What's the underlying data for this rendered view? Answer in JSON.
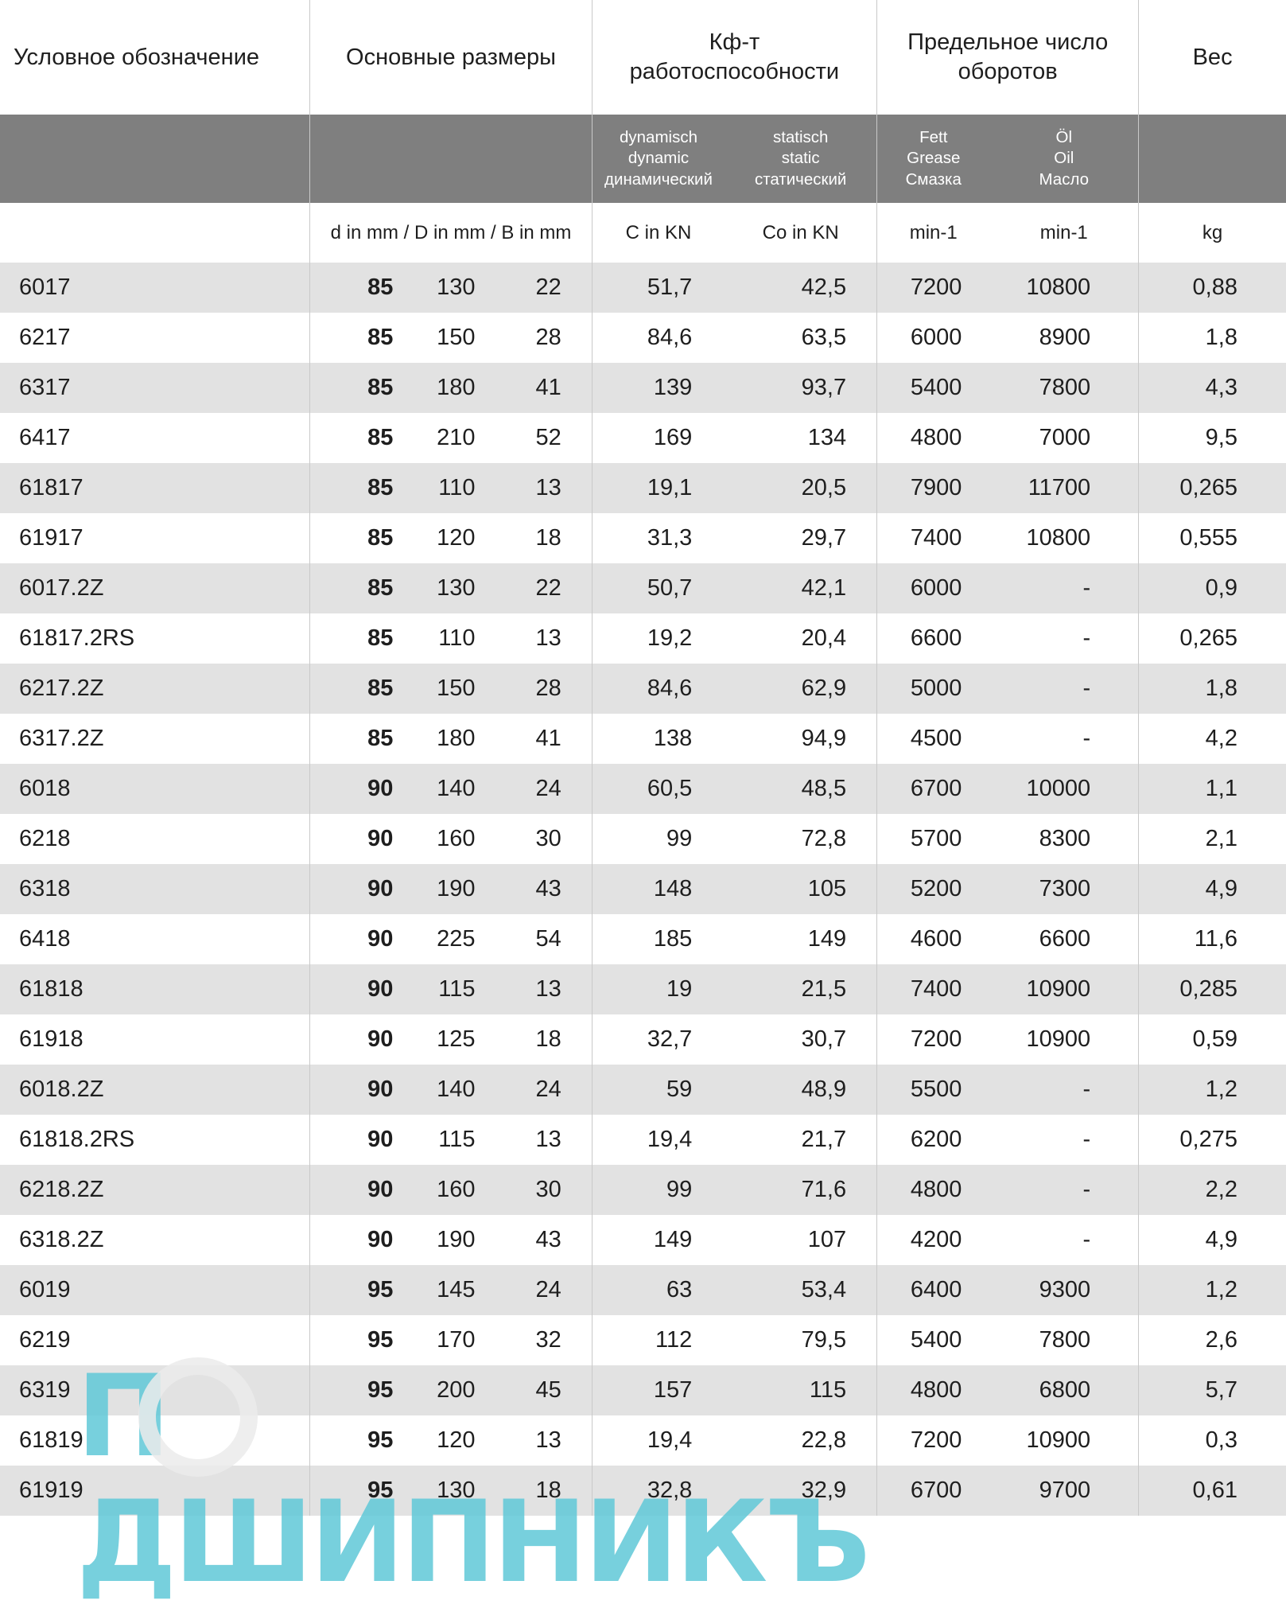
{
  "headers": {
    "designation": "Условное обозначение",
    "dimensions": "Основные размеры",
    "load_line1": "Кф-т",
    "load_line2": "работоспособности",
    "speed_line1": "Предельное число",
    "speed_line2": "оборотов",
    "weight": "Вес"
  },
  "subheaders": {
    "dynamic": [
      "dynamisch",
      "dynamic",
      "динамический"
    ],
    "static": [
      "statisch",
      "static",
      "статический"
    ],
    "grease": [
      "Fett",
      "Grease",
      "Смазка"
    ],
    "oil": [
      "Öl",
      "Oil",
      "Масло"
    ]
  },
  "units": {
    "dimensions": "d in mm / D in mm / B in mm",
    "c": "C in KN",
    "co": "Co in KN",
    "grease": "min-1",
    "oil": "min-1",
    "weight": "kg"
  },
  "rows": [
    [
      "6017",
      "85",
      "130",
      "22",
      "51,7",
      "42,5",
      "7200",
      "10800",
      "0,88"
    ],
    [
      "6217",
      "85",
      "150",
      "28",
      "84,6",
      "63,5",
      "6000",
      "8900",
      "1,8"
    ],
    [
      "6317",
      "85",
      "180",
      "41",
      "139",
      "93,7",
      "5400",
      "7800",
      "4,3"
    ],
    [
      "6417",
      "85",
      "210",
      "52",
      "169",
      "134",
      "4800",
      "7000",
      "9,5"
    ],
    [
      "61817",
      "85",
      "110",
      "13",
      "19,1",
      "20,5",
      "7900",
      "11700",
      "0,265"
    ],
    [
      "61917",
      "85",
      "120",
      "18",
      "31,3",
      "29,7",
      "7400",
      "10800",
      "0,555"
    ],
    [
      "6017.2Z",
      "85",
      "130",
      "22",
      "50,7",
      "42,1",
      "6000",
      "-",
      "0,9"
    ],
    [
      "61817.2RS",
      "85",
      "110",
      "13",
      "19,2",
      "20,4",
      "6600",
      "-",
      "0,265"
    ],
    [
      "6217.2Z",
      "85",
      "150",
      "28",
      "84,6",
      "62,9",
      "5000",
      "-",
      "1,8"
    ],
    [
      "6317.2Z",
      "85",
      "180",
      "41",
      "138",
      "94,9",
      "4500",
      "-",
      "4,2"
    ],
    [
      "6018",
      "90",
      "140",
      "24",
      "60,5",
      "48,5",
      "6700",
      "10000",
      "1,1"
    ],
    [
      "6218",
      "90",
      "160",
      "30",
      "99",
      "72,8",
      "5700",
      "8300",
      "2,1"
    ],
    [
      "6318",
      "90",
      "190",
      "43",
      "148",
      "105",
      "5200",
      "7300",
      "4,9"
    ],
    [
      "6418",
      "90",
      "225",
      "54",
      "185",
      "149",
      "4600",
      "6600",
      "11,6"
    ],
    [
      "61818",
      "90",
      "115",
      "13",
      "19",
      "21,5",
      "7400",
      "10900",
      "0,285"
    ],
    [
      "61918",
      "90",
      "125",
      "18",
      "32,7",
      "30,7",
      "7200",
      "10900",
      "0,59"
    ],
    [
      "6018.2Z",
      "90",
      "140",
      "24",
      "59",
      "48,9",
      "5500",
      "-",
      "1,2"
    ],
    [
      "61818.2RS",
      "90",
      "115",
      "13",
      "19,4",
      "21,7",
      "6200",
      "-",
      "0,275"
    ],
    [
      "6218.2Z",
      "90",
      "160",
      "30",
      "99",
      "71,6",
      "4800",
      "-",
      "2,2"
    ],
    [
      "6318.2Z",
      "90",
      "190",
      "43",
      "149",
      "107",
      "4200",
      "-",
      "4,9"
    ],
    [
      "6019",
      "95",
      "145",
      "24",
      "63",
      "53,4",
      "6400",
      "9300",
      "1,2"
    ],
    [
      "6219",
      "95",
      "170",
      "32",
      "112",
      "79,5",
      "5400",
      "7800",
      "2,6"
    ],
    [
      "6319",
      "95",
      "200",
      "45",
      "157",
      "115",
      "4800",
      "6800",
      "5,7"
    ],
    [
      "61819",
      "95",
      "120",
      "13",
      "19,4",
      "22,8",
      "7200",
      "10900",
      "0,3"
    ],
    [
      "61919",
      "95",
      "130",
      "18",
      "32,8",
      "32,9",
      "6700",
      "9700",
      "0,61"
    ]
  ],
  "watermark": {
    "text": "П ДШИПНИКЪ",
    "color": "#5fc8d7"
  }
}
